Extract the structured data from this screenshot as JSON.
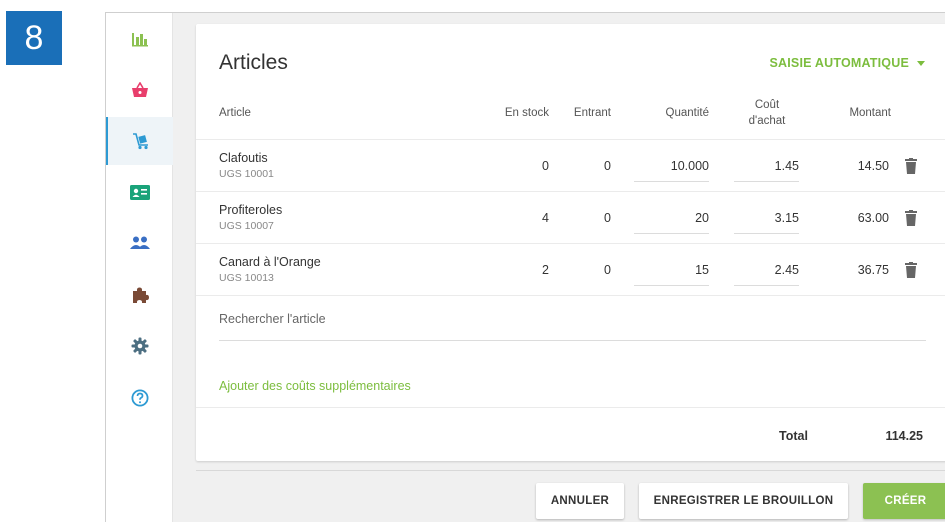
{
  "step_number": "8",
  "sidebar": {
    "items": [
      {
        "name": "dashboard",
        "icon": "bar-chart-icon",
        "color": "#8cc152"
      },
      {
        "name": "sales",
        "icon": "basket-icon",
        "color": "#e83e6c"
      },
      {
        "name": "purchases",
        "icon": "cart-dolly-icon",
        "color": "#2d9ad3",
        "active": true
      },
      {
        "name": "contacts",
        "icon": "id-card-icon",
        "color": "#1aa37a"
      },
      {
        "name": "team",
        "icon": "users-icon",
        "color": "#3a6fc4"
      },
      {
        "name": "integrations",
        "icon": "puzzle-icon",
        "color": "#7a4a36"
      },
      {
        "name": "settings",
        "icon": "gear-icon",
        "color": "#4d6f82"
      },
      {
        "name": "help",
        "icon": "help-circle-icon",
        "color": "#2d9ad3"
      }
    ]
  },
  "card": {
    "title": "Articles",
    "auto_entry_label": "SAISIE AUTOMATIQUE"
  },
  "table": {
    "headers": {
      "article": "Article",
      "in_stock": "En stock",
      "incoming": "Entrant",
      "quantity": "Quantité",
      "cost_line1": "Coût",
      "cost_line2": "d'achat",
      "amount": "Montant"
    },
    "rows": [
      {
        "name": "Clafoutis",
        "sku": "UGS 10001",
        "in_stock": "0",
        "incoming": "0",
        "quantity": "10.000",
        "cost": "1.45",
        "amount": "14.50"
      },
      {
        "name": "Profiteroles",
        "sku": "UGS 10007",
        "in_stock": "4",
        "incoming": "0",
        "quantity": "20",
        "cost": "3.15",
        "amount": "63.00"
      },
      {
        "name": "Canard à l'Orange",
        "sku": "UGS 10013",
        "in_stock": "2",
        "incoming": "0",
        "quantity": "15",
        "cost": "2.45",
        "amount": "36.75"
      }
    ],
    "search_placeholder": "Rechercher l'article",
    "add_costs_label": "Ajouter des coûts supplémentaires",
    "total_label": "Total",
    "total_value": "114.25"
  },
  "footer": {
    "cancel_label": "ANNULER",
    "save_draft_label": "ENREGISTRER LE BROUILLON",
    "create_label": "CRÉER"
  },
  "colors": {
    "accent_green": "#8cc152",
    "link_green": "#7cbd3e",
    "badge_blue": "#1a6fb8"
  }
}
